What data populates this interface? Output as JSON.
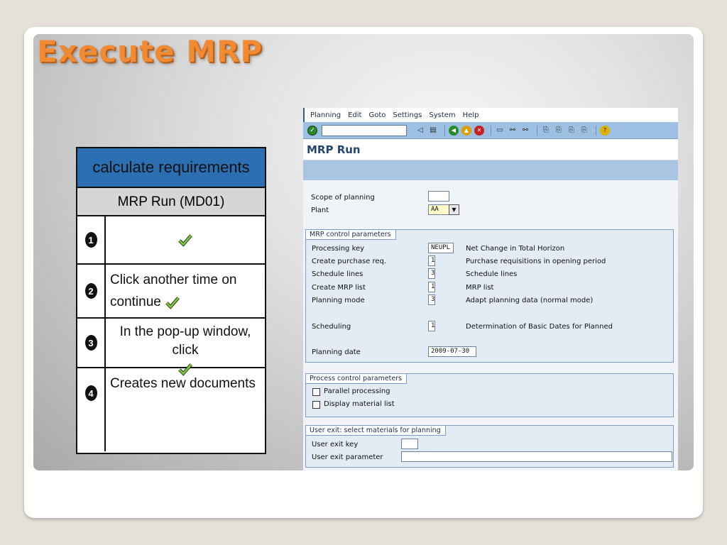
{
  "slide": {
    "title": "Execute MRP"
  },
  "steps_table": {
    "header": "calculate requirements",
    "subheader": "MRP Run (MD01)",
    "rows": [
      {
        "num": "1",
        "text": ""
      },
      {
        "num": "2",
        "text": "Click another time on continue"
      },
      {
        "num": "3",
        "text": "In the pop-up window, click"
      },
      {
        "num": "4",
        "text": "Creates new documents"
      }
    ]
  },
  "sap": {
    "menu": [
      "Planning",
      "Edit",
      "Goto",
      "Settings",
      "System",
      "Help"
    ],
    "title": "MRP Run",
    "scope_label": "Scope of planning",
    "scope_value": "",
    "plant_label": "Plant",
    "plant_value": "AA",
    "mrp_group": {
      "title": "MRP control parameters",
      "processing_key_label": "Processing key",
      "processing_key_value": "NEUPL",
      "processing_key_desc": "Net Change in Total Horizon",
      "create_pr_label": "Create purchase req.",
      "create_pr_value": "1",
      "create_pr_desc": "Purchase requisitions in opening period",
      "schedule_lines_label": "Schedule lines",
      "schedule_lines_value": "3",
      "schedule_lines_desc": "Schedule lines",
      "create_mrp_list_label": "Create MRP list",
      "create_mrp_list_value": "1",
      "create_mrp_list_desc": "MRP list",
      "planning_mode_label": "Planning mode",
      "planning_mode_value": "3",
      "planning_mode_desc": "Adapt planning data (normal mode)",
      "scheduling_label": "Scheduling",
      "scheduling_value": "1",
      "scheduling_desc": "Determination of Basic Dates for Planned",
      "planning_date_label": "Planning date",
      "planning_date_value": "2009-07-30"
    },
    "process_group": {
      "title": "Process control parameters",
      "parallel_label": "Parallel processing",
      "display_list_label": "Display material list"
    },
    "user_exit_group": {
      "title": "User exit: select materials for planning",
      "key_label": "User exit key",
      "param_label": "User exit parameter"
    }
  }
}
